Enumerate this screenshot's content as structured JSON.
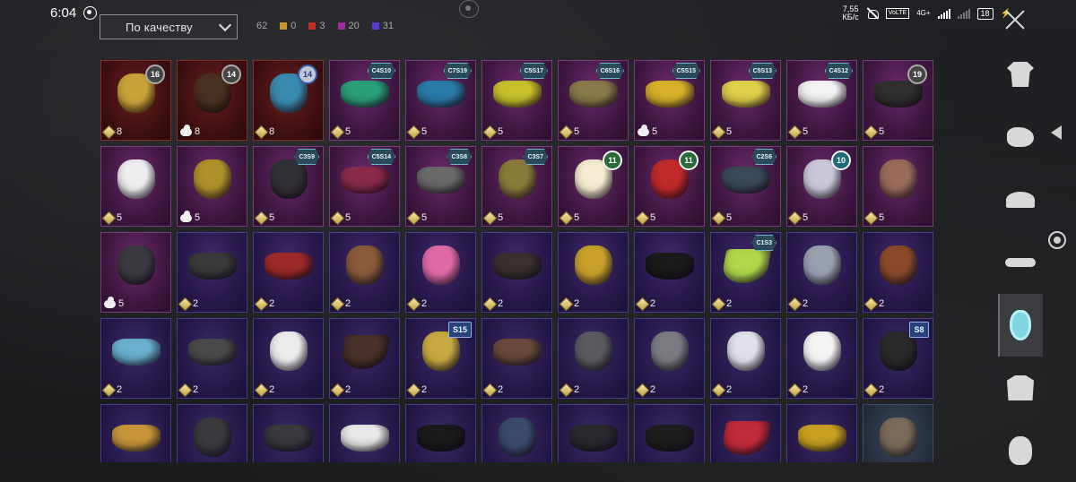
{
  "status": {
    "time": "6:04",
    "speed_value": "7,55",
    "speed_unit": "КБ/с",
    "volte": "VoLTE",
    "network": "4G+",
    "battery": "18"
  },
  "sort": {
    "label": "По качеству"
  },
  "counts": [
    {
      "value": "62",
      "color": "#a8a8a8"
    },
    {
      "value": "0",
      "color": "#c8962a"
    },
    {
      "value": "3",
      "color": "#c0302a"
    },
    {
      "value": "20",
      "color": "#a02aa0"
    },
    {
      "value": "31",
      "color": "#5a3ad0"
    }
  ],
  "items": [
    {
      "rarity": "legend",
      "badge": "16",
      "badge_style": "",
      "tag": "",
      "count": "8",
      "icon": "diamond",
      "art": "#c9a23a"
    },
    {
      "rarity": "legend",
      "badge": "14",
      "badge_style": "",
      "tag": "",
      "count": "8",
      "icon": "cloud",
      "art": "#4a3020"
    },
    {
      "rarity": "legend",
      "badge": "14",
      "badge_style": "lvblue",
      "tag": "",
      "count": "8",
      "icon": "diamond",
      "art": "#3a8ab0"
    },
    {
      "rarity": "epic",
      "badge": "",
      "badge_style": "",
      "tag": "C4S10",
      "count": "5",
      "icon": "diamond",
      "art": "#2aa07a",
      "shape": "wide"
    },
    {
      "rarity": "epic",
      "badge": "",
      "badge_style": "",
      "tag": "C7S19",
      "count": "5",
      "icon": "diamond",
      "art": "#2a7aa8",
      "shape": "wide"
    },
    {
      "rarity": "epic",
      "badge": "",
      "badge_style": "",
      "tag": "C5S17",
      "count": "5",
      "icon": "diamond",
      "art": "#c8c02a",
      "shape": "wide"
    },
    {
      "rarity": "epic",
      "badge": "",
      "badge_style": "",
      "tag": "C6S16",
      "count": "5",
      "icon": "diamond",
      "art": "#8a7a4a",
      "shape": "wide"
    },
    {
      "rarity": "epic",
      "badge": "",
      "badge_style": "",
      "tag": "C5S15",
      "count": "5",
      "icon": "cloud",
      "art": "#d8b02a",
      "shape": "wide"
    },
    {
      "rarity": "epic",
      "badge": "",
      "badge_style": "",
      "tag": "C5S13",
      "count": "5",
      "icon": "diamond",
      "art": "#e0d04a",
      "shape": "wide"
    },
    {
      "rarity": "epic",
      "badge": "",
      "badge_style": "",
      "tag": "C4S12",
      "count": "5",
      "icon": "diamond",
      "art": "#f2f2f2",
      "shape": "wide"
    },
    {
      "rarity": "epic",
      "badge": "19",
      "badge_style": "",
      "tag": "",
      "count": "5",
      "icon": "diamond",
      "art": "#303030",
      "shape": "wide"
    },
    {
      "rarity": "epic",
      "badge": "",
      "badge_style": "",
      "tag": "",
      "count": "5",
      "icon": "diamond",
      "art": "#eeeeee"
    },
    {
      "rarity": "epic",
      "badge": "",
      "badge_style": "",
      "tag": "",
      "count": "5",
      "icon": "cloud",
      "art": "#b0902a"
    },
    {
      "rarity": "epic",
      "badge": "",
      "badge_style": "",
      "tag": "C3S9",
      "count": "5",
      "icon": "diamond",
      "art": "#303036"
    },
    {
      "rarity": "epic",
      "badge": "",
      "badge_style": "",
      "tag": "C5S14",
      "count": "5",
      "icon": "diamond",
      "art": "#8a2a4a",
      "shape": "wide"
    },
    {
      "rarity": "epic",
      "badge": "",
      "badge_style": "",
      "tag": "C3S8",
      "count": "5",
      "icon": "diamond",
      "art": "#6a6a6a",
      "shape": "wide"
    },
    {
      "rarity": "epic",
      "badge": "",
      "badge_style": "",
      "tag": "C3S7",
      "count": "5",
      "icon": "diamond",
      "art": "#8a7a3a"
    },
    {
      "rarity": "epic",
      "badge": "11",
      "badge_style": "green",
      "tag": "",
      "count": "5",
      "icon": "diamond",
      "art": "#f4ecd0"
    },
    {
      "rarity": "epic",
      "badge": "11",
      "badge_style": "green",
      "tag": "",
      "count": "5",
      "icon": "diamond",
      "art": "#c02a2a"
    },
    {
      "rarity": "epic",
      "badge": "",
      "badge_style": "",
      "tag": "C2S6",
      "count": "5",
      "icon": "diamond",
      "art": "#3a4a5a",
      "shape": "wide"
    },
    {
      "rarity": "epic",
      "badge": "10",
      "badge_style": "cyan",
      "tag": "",
      "count": "5",
      "icon": "diamond",
      "art": "#c8c8d8"
    },
    {
      "rarity": "epic",
      "badge": "",
      "badge_style": "",
      "tag": "",
      "count": "5",
      "icon": "diamond",
      "art": "#9a6a5a"
    },
    {
      "rarity": "epic",
      "badge": "",
      "badge_style": "",
      "tag": "",
      "count": "5",
      "icon": "cloud",
      "art": "#3a3a40"
    },
    {
      "rarity": "rare",
      "badge": "",
      "badge_style": "",
      "tag": "",
      "count": "2",
      "icon": "diamond",
      "art": "#3a3a3a",
      "shape": "wide"
    },
    {
      "rarity": "rare",
      "badge": "",
      "badge_style": "",
      "tag": "",
      "count": "2",
      "icon": "diamond",
      "art": "#a02a2a",
      "shape": "wide"
    },
    {
      "rarity": "rare",
      "badge": "",
      "badge_style": "",
      "tag": "",
      "count": "2",
      "icon": "diamond",
      "art": "#8a5a3a"
    },
    {
      "rarity": "rare",
      "badge": "",
      "badge_style": "",
      "tag": "",
      "count": "2",
      "icon": "diamond",
      "art": "#e06aa8"
    },
    {
      "rarity": "rare",
      "badge": "",
      "badge_style": "",
      "tag": "",
      "count": "2",
      "icon": "diamond",
      "art": "#3a3030",
      "shape": "wide"
    },
    {
      "rarity": "rare",
      "badge": "",
      "badge_style": "",
      "tag": "",
      "count": "2",
      "icon": "diamond",
      "art": "#c8a02a"
    },
    {
      "rarity": "rare",
      "badge": "",
      "badge_style": "",
      "tag": "",
      "count": "2",
      "icon": "diamond",
      "art": "#1a1a1a",
      "shape": "wide"
    },
    {
      "rarity": "rare",
      "badge": "",
      "badge_style": "",
      "tag": "C1S3",
      "count": "2",
      "icon": "diamond",
      "art": "#b0d84a",
      "shape": "bandana"
    },
    {
      "rarity": "rare",
      "badge": "",
      "badge_style": "",
      "tag": "",
      "count": "2",
      "icon": "diamond",
      "art": "#9aa0b0"
    },
    {
      "rarity": "rare",
      "badge": "",
      "badge_style": "",
      "tag": "",
      "count": "2",
      "icon": "diamond",
      "art": "#8a4a2a"
    },
    {
      "rarity": "rare2",
      "badge": "",
      "badge_style": "",
      "tag": "",
      "count": "2",
      "icon": "diamond",
      "art": "#6ab0d0",
      "shape": "wide"
    },
    {
      "rarity": "rare2",
      "badge": "",
      "badge_style": "",
      "tag": "",
      "count": "2",
      "icon": "diamond",
      "art": "#4a4a4a",
      "shape": "wide"
    },
    {
      "rarity": "rare2",
      "badge": "",
      "badge_style": "",
      "tag": "",
      "count": "2",
      "icon": "diamond",
      "art": "#ececec"
    },
    {
      "rarity": "rare2",
      "badge": "",
      "badge_style": "",
      "tag": "",
      "count": "2",
      "icon": "diamond",
      "art": "#4a3028",
      "shape": "bandana"
    },
    {
      "rarity": "rare2",
      "badge": "",
      "badge_style": "",
      "tag": "S15",
      "count": "2",
      "icon": "diamond",
      "art": "#c8a840",
      "season": true
    },
    {
      "rarity": "rare2",
      "badge": "",
      "badge_style": "",
      "tag": "",
      "count": "2",
      "icon": "diamond",
      "art": "#6a4a3a",
      "shape": "wide"
    },
    {
      "rarity": "rare2",
      "badge": "",
      "badge_style": "",
      "tag": "",
      "count": "2",
      "icon": "diamond",
      "art": "#5a5a60"
    },
    {
      "rarity": "rare2",
      "badge": "",
      "badge_style": "",
      "tag": "",
      "count": "2",
      "icon": "diamond",
      "art": "#7a7a80"
    },
    {
      "rarity": "rare2",
      "badge": "",
      "badge_style": "",
      "tag": "",
      "count": "2",
      "icon": "diamond",
      "art": "#e0e0e8"
    },
    {
      "rarity": "rare2",
      "badge": "",
      "badge_style": "",
      "tag": "",
      "count": "2",
      "icon": "diamond",
      "art": "#f4f4f4"
    },
    {
      "rarity": "rare2",
      "badge": "",
      "badge_style": "",
      "tag": "S8",
      "count": "2",
      "icon": "diamond",
      "art": "#2a2a2a",
      "season": true
    },
    {
      "rarity": "rare2",
      "badge": "",
      "badge_style": "",
      "tag": "",
      "count": "",
      "icon": "",
      "art": "#c8963a",
      "shape": "wide"
    },
    {
      "rarity": "rare2",
      "badge": "",
      "badge_style": "",
      "tag": "",
      "count": "",
      "icon": "",
      "art": "#3a3a3e"
    },
    {
      "rarity": "rare2",
      "badge": "",
      "badge_style": "",
      "tag": "",
      "count": "",
      "icon": "",
      "art": "#3a3a3e",
      "shape": "wide"
    },
    {
      "rarity": "rare2",
      "badge": "",
      "badge_style": "",
      "tag": "",
      "count": "",
      "icon": "",
      "art": "#e8e8e8",
      "shape": "wide"
    },
    {
      "rarity": "rare2",
      "badge": "",
      "badge_style": "",
      "tag": "",
      "count": "",
      "icon": "",
      "art": "#1a1a1a",
      "shape": "wide"
    },
    {
      "rarity": "rare2",
      "badge": "",
      "badge_style": "",
      "tag": "",
      "count": "",
      "icon": "",
      "art": "#3a4a6a"
    },
    {
      "rarity": "rare2",
      "badge": "",
      "badge_style": "",
      "tag": "",
      "count": "",
      "icon": "",
      "art": "#2a2a2e",
      "shape": "wide"
    },
    {
      "rarity": "rare2",
      "badge": "",
      "badge_style": "",
      "tag": "",
      "count": "",
      "icon": "",
      "art": "#1e1e1e",
      "shape": "wide"
    },
    {
      "rarity": "rare2",
      "badge": "",
      "badge_style": "",
      "tag": "",
      "count": "",
      "icon": "",
      "art": "#c02a3a",
      "shape": "bandana"
    },
    {
      "rarity": "rare2",
      "badge": "",
      "badge_style": "",
      "tag": "",
      "count": "",
      "icon": "",
      "art": "#c8a020",
      "shape": "wide"
    },
    {
      "rarity": "uncommon",
      "badge": "",
      "badge_style": "",
      "tag": "",
      "count": "",
      "icon": "",
      "art": "#7a6a5a"
    }
  ],
  "sidebar": [
    {
      "name": "outfit-icon",
      "shape": "s-shirt",
      "active": false
    },
    {
      "name": "gloves-icon",
      "shape": "s-glove",
      "active": false
    },
    {
      "name": "cap-icon",
      "shape": "s-cap",
      "active": false
    },
    {
      "name": "glasses-icon",
      "shape": "s-glasses",
      "active": false
    },
    {
      "name": "mask-icon",
      "shape": "s-mask",
      "active": true
    },
    {
      "name": "jacket-icon",
      "shape": "s-jacket",
      "active": false
    },
    {
      "name": "helmet-icon",
      "shape": "s-helmet",
      "active": false
    }
  ]
}
